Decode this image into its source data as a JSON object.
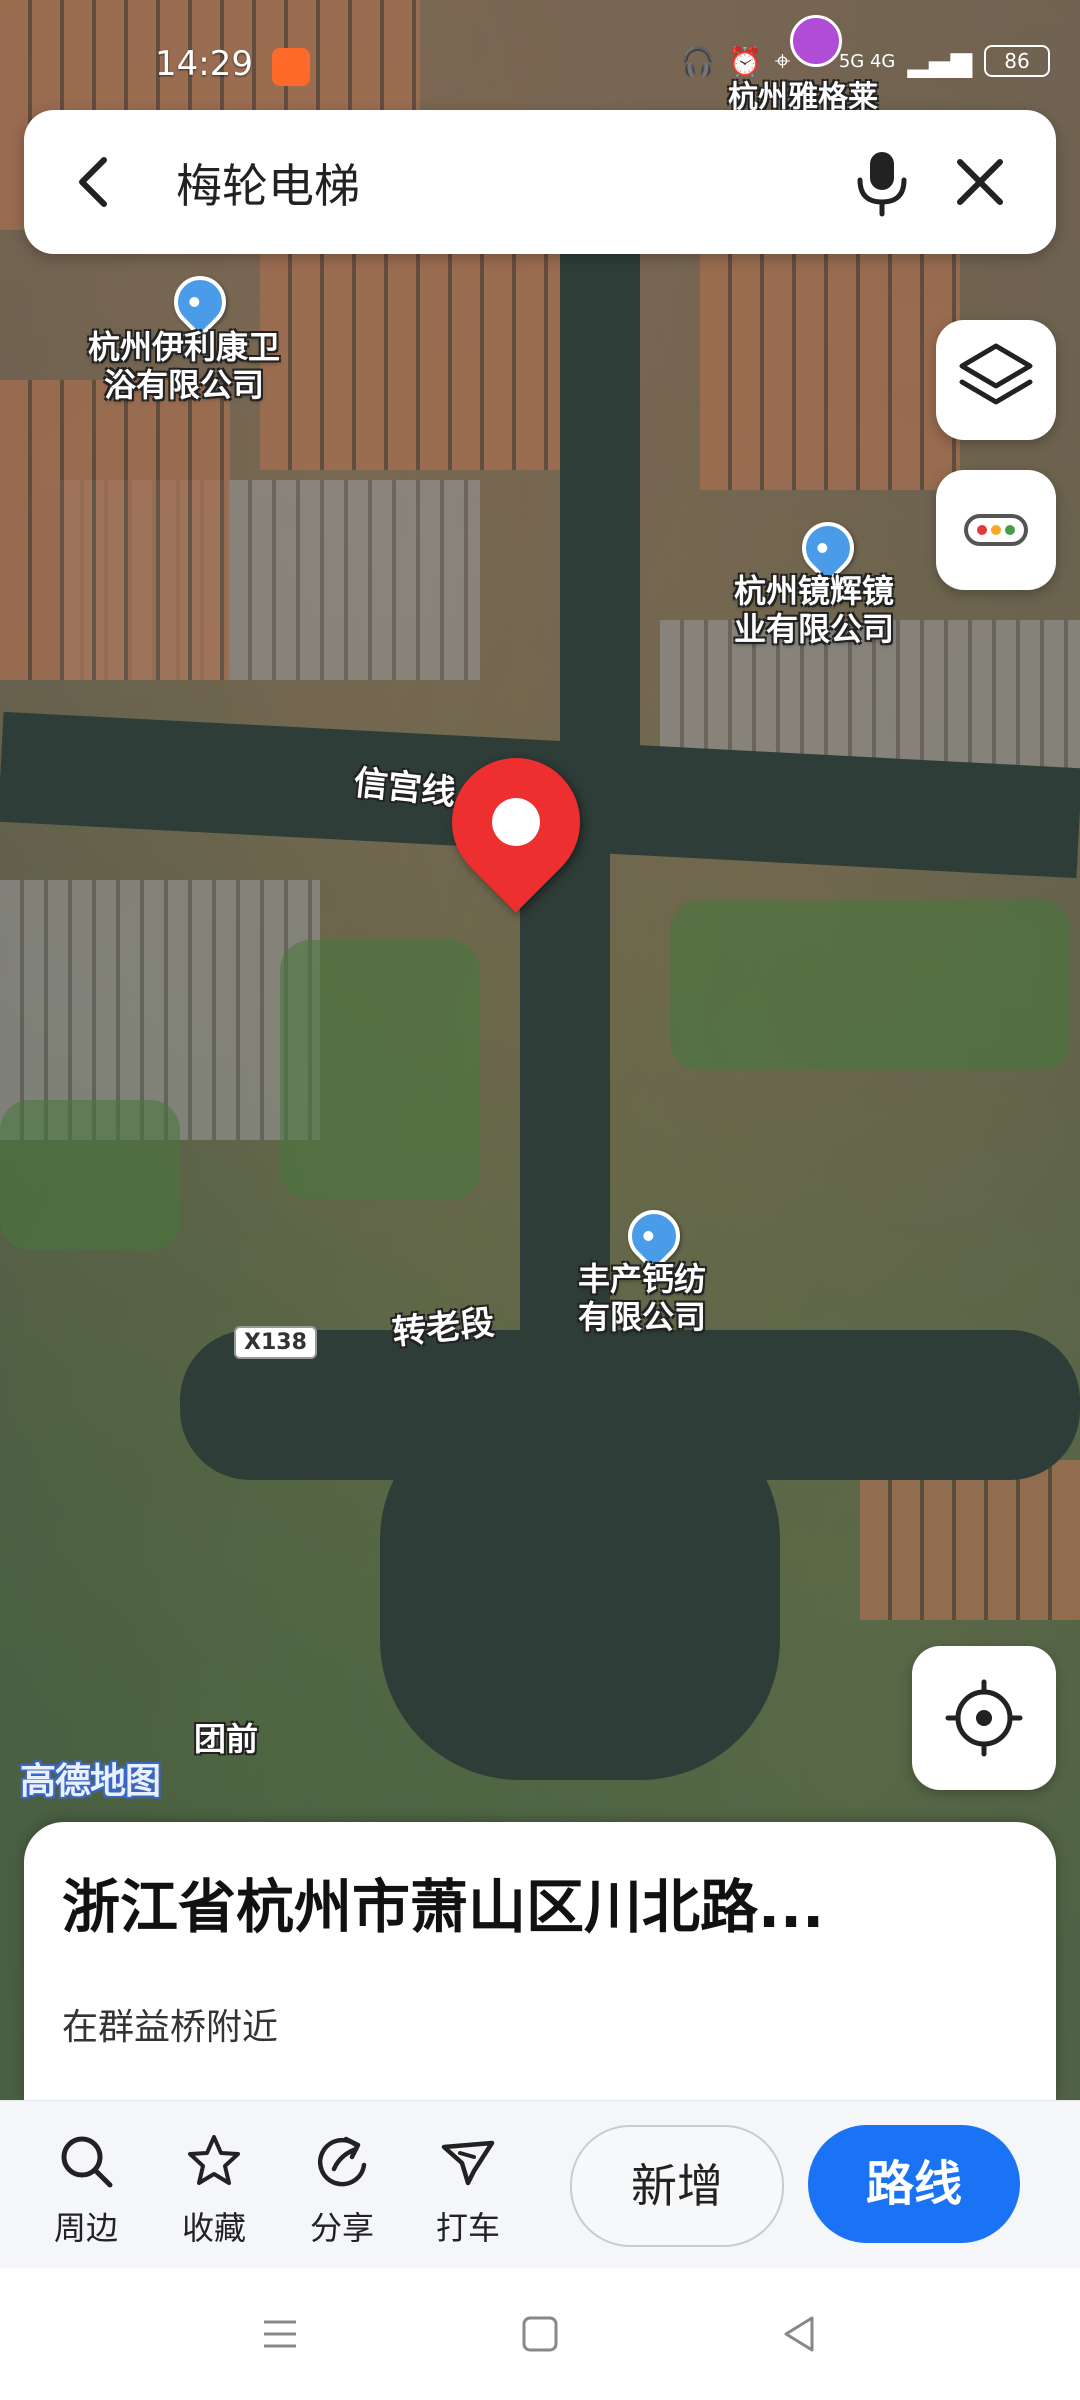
{
  "status_bar": {
    "time": "14:29",
    "battery": "86",
    "network": "5G 4G"
  },
  "map": {
    "city_label": "杭州雅格莱",
    "pois": [
      {
        "label": "杭州伊利康卫\n浴有限公司"
      },
      {
        "label": "杭州镜辉镜\n业有限公司"
      },
      {
        "label": "丰产钙纺\n有限公司"
      }
    ],
    "road_labels": [
      "信宫线",
      "转老段",
      "团前"
    ],
    "road_shield": "X138",
    "logo": "高德地图"
  },
  "search": {
    "query": "梅轮电梯"
  },
  "place_card": {
    "title": "浙江省杭州市萧山区川北路...",
    "subtitle": "在群益桥附近"
  },
  "actions": {
    "nearby": "周边",
    "favorite": "收藏",
    "share": "分享",
    "taxi": "打车",
    "add": "新增",
    "route": "路线"
  },
  "colors": {
    "accent": "#1a73f5",
    "pin": "#ee2f2f",
    "poi": "#4a9be8"
  }
}
